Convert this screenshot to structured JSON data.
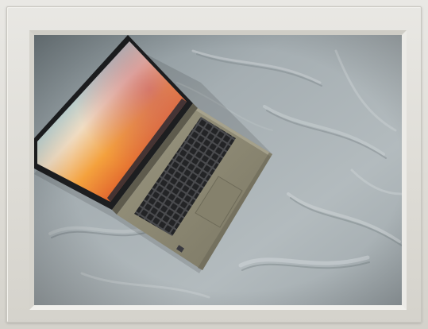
{
  "scene": {
    "subject": "laptop-on-bedsheet",
    "frame_color": "#e3e1dc",
    "sheet_color": "#9aa4a8",
    "laptop_body_color": "#8e8a74",
    "keyboard_color": "#2c2d2f",
    "screen_gradient": [
      "#6fb9d6",
      "#e9e3d8",
      "#f08a2c",
      "#c83d3a",
      "#3a2b6a"
    ]
  }
}
